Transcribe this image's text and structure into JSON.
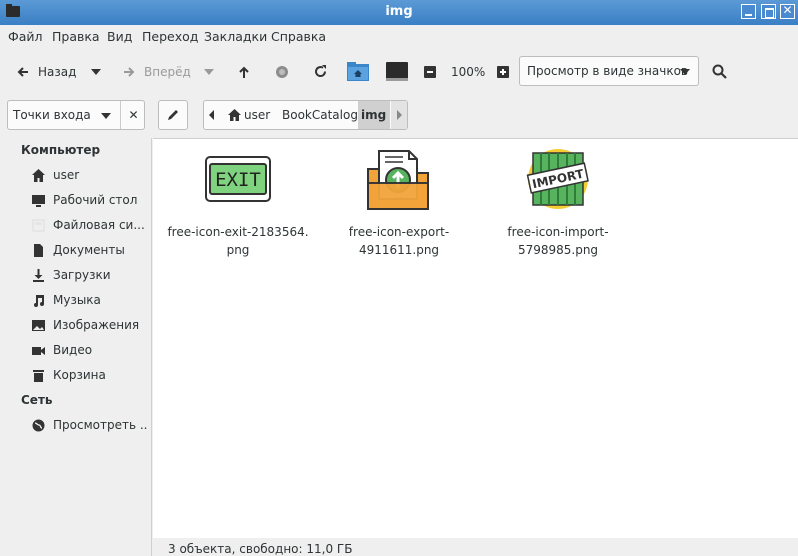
{
  "window": {
    "title": "img"
  },
  "menu": [
    "Файл",
    "Правка",
    "Вид",
    "Переход",
    "Закладки",
    "Справка"
  ],
  "toolbar": {
    "back_label": "Назад",
    "forward_label": "Вперёд",
    "zoom_level": "100%",
    "view_mode": "Просмотр в виде значков"
  },
  "location": {
    "places_label": "Точки входа",
    "crumbs": [
      "user",
      "BookCatalog",
      "img"
    ]
  },
  "sidebar": {
    "computer_header": "Компьютер",
    "computer_items": [
      {
        "label": "user",
        "icon": "home-icon"
      },
      {
        "label": "Рабочий стол",
        "icon": "desktop-icon"
      },
      {
        "label": "Файловая си...",
        "icon": "filesystem-icon"
      },
      {
        "label": "Документы",
        "icon": "documents-icon"
      },
      {
        "label": "Загрузки",
        "icon": "download-icon"
      },
      {
        "label": "Музыка",
        "icon": "music-icon"
      },
      {
        "label": "Изображения",
        "icon": "pictures-icon"
      },
      {
        "label": "Видео",
        "icon": "video-icon"
      },
      {
        "label": "Корзина",
        "icon": "trash-icon"
      }
    ],
    "network_header": "Сеть",
    "network_items": [
      {
        "label": "Просмотреть ...",
        "icon": "globe-icon"
      }
    ]
  },
  "files": [
    {
      "name_line1": "free-icon-exit-2183564.",
      "name_line2": "png",
      "icon": "exit-sign-icon"
    },
    {
      "name_line1": "free-icon-export-",
      "name_line2": "4911611.png",
      "icon": "export-folder-icon"
    },
    {
      "name_line1": "free-icon-import-",
      "name_line2": "5798985.png",
      "icon": "import-box-icon"
    }
  ],
  "status": {
    "text": "3 объекта, свободно: 11,0 ГБ"
  },
  "colors": {
    "titlebar": "#3a7fc4",
    "exit_green": "#7fd37f",
    "folder_orange": "#f2a43a",
    "import_green": "#57b35d",
    "import_yellow": "#f5cc33"
  }
}
